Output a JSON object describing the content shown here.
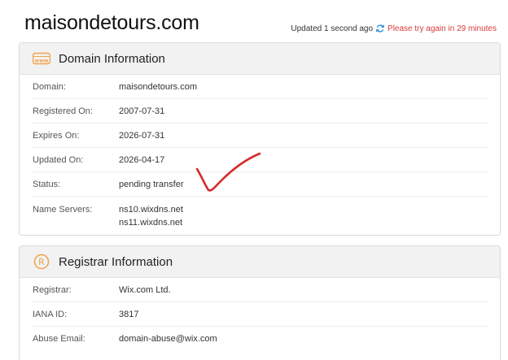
{
  "header": {
    "site_title": "maisondetours.com",
    "updated_text": "Updated 1 second ago",
    "retry_text": "Please try again in 29 minutes"
  },
  "domain_info": {
    "title": "Domain Information",
    "icon": "www-icon",
    "rows": [
      {
        "label": "Domain:",
        "value": "maisondetours.com"
      },
      {
        "label": "Registered On:",
        "value": "2007-07-31"
      },
      {
        "label": "Expires On:",
        "value": "2026-07-31"
      },
      {
        "label": "Updated On:",
        "value": "2026-04-17"
      },
      {
        "label": "Status:",
        "value": "pending transfer"
      }
    ],
    "name_servers": {
      "label": "Name Servers:",
      "values": [
        "ns10.wixdns.net",
        "ns11.wixdns.net"
      ]
    }
  },
  "registrar_info": {
    "title": "Registrar Information",
    "icon": "registered-icon",
    "rows": [
      {
        "label": "Registrar:",
        "value": "Wix.com Ltd."
      },
      {
        "label": "IANA ID:",
        "value": "3817"
      },
      {
        "label": "Abuse Email:",
        "value": "domain-abuse@wix.com"
      }
    ]
  },
  "colors": {
    "accent_orange": "#f0a24b",
    "refresh_blue": "#2f8fd8",
    "retry_red": "#d93b3b",
    "annotation_red": "#d42b2b"
  }
}
